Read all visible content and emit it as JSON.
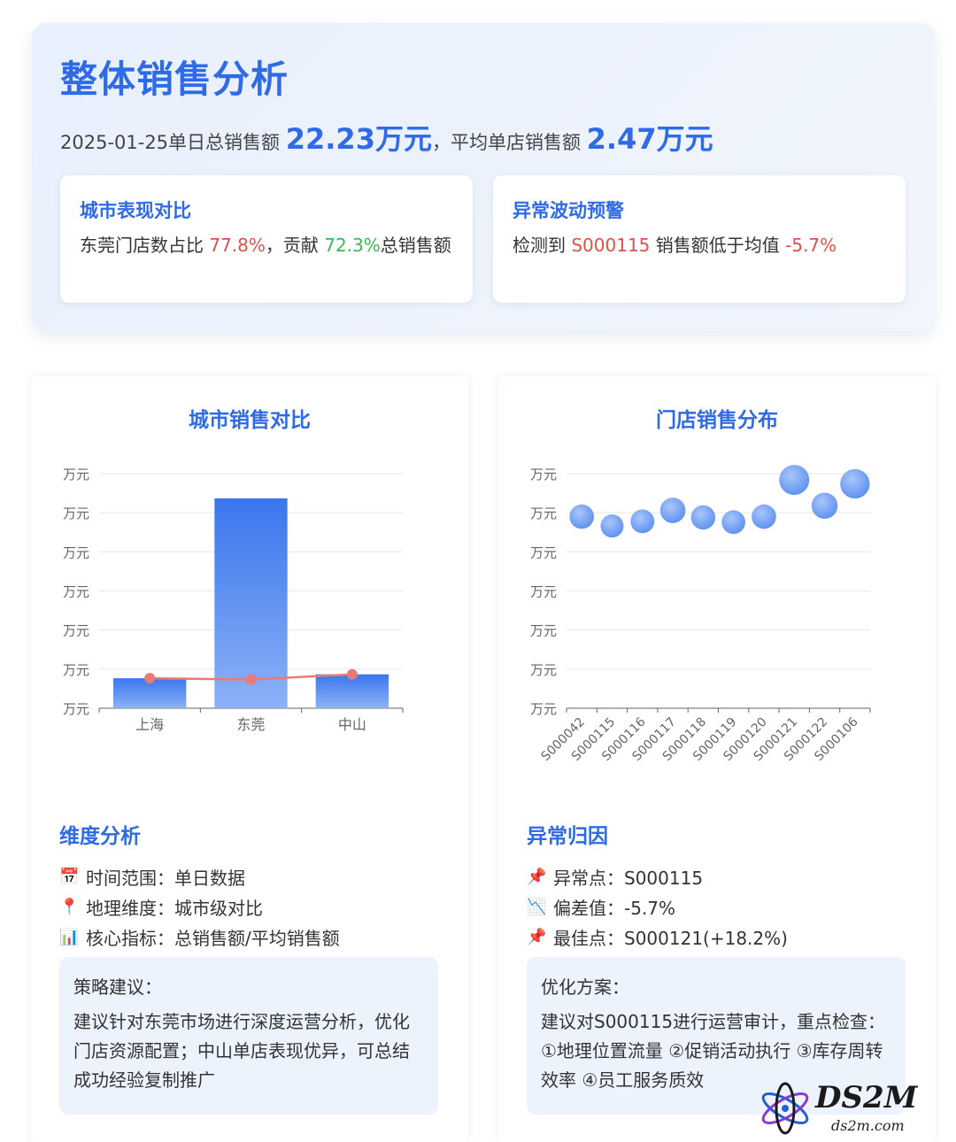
{
  "hero": {
    "title": "整体销售分析",
    "prefix": "2025-01-25单日总销售额",
    "total": "22.23万元",
    "sep": "，平均单店销售额",
    "avg": "2.47万元"
  },
  "cards": [
    {
      "title": "城市表现对比",
      "text_a": "东莞门店数占比",
      "val_a": "77.8%",
      "text_b": "，贡献",
      "val_b": "72.3%",
      "text_c": "总销售额"
    },
    {
      "title": "异常波动预警",
      "text_a": "检测到",
      "val_a": "S000115",
      "text_b": "销售额低于均值",
      "val_b": "-5.7%"
    }
  ],
  "left_panel": {
    "title": "城市销售对比",
    "section_title": "维度分析",
    "dims": [
      {
        "icon": "calendar-icon",
        "label": "时间范围：单日数据"
      },
      {
        "icon": "pin-icon",
        "label": "地理维度：城市级对比"
      },
      {
        "icon": "bar-chart-icon",
        "label": "核心指标：总销售额/平均销售额"
      }
    ],
    "box_title": "策略建议：",
    "box_text": "建议针对东莞市场进行深度运营分析，优化门店资源配置；中山单店表现优异，可总结成功经验复制推广"
  },
  "right_panel": {
    "title": "门店销售分布",
    "section_title": "异常归因",
    "dims": [
      {
        "icon": "pushpin-icon",
        "label": "异常点：S000115"
      },
      {
        "icon": "trend-down-icon",
        "label": "偏差值：-5.7%"
      },
      {
        "icon": "pushpin-icon",
        "label": "最佳点：S000121(+18.2%)"
      }
    ],
    "box_title": "优化方案：",
    "box_text": "建议对S000115进行运营审计，重点检查：①地理位置流量 ②促销活动执行 ③库存周转效率 ④员工服务质效"
  },
  "chart_data": [
    {
      "type": "bar",
      "title": "城市销售对比",
      "categories": [
        "上海",
        "东莞",
        "中山"
      ],
      "y_tick_labels": [
        "万元",
        "万元",
        "万元",
        "万元",
        "万元",
        "万元",
        "万元"
      ],
      "series": [
        {
          "kind": "bar",
          "values": [
            2.3,
            16.1,
            2.6
          ]
        },
        {
          "kind": "line",
          "values": [
            2.3,
            2.2,
            2.6
          ]
        }
      ],
      "ylim": [
        0,
        18
      ],
      "colors": {
        "bar_top": "#3a76ee",
        "bar_bottom": "#8cb1f6",
        "line": "#ea7a78"
      }
    },
    {
      "type": "scatter",
      "title": "门店销售分布",
      "categories": [
        "S000042",
        "S000115",
        "S000116",
        "S000117",
        "S000118",
        "S000119",
        "S000120",
        "S000121",
        "S000122",
        "S000106"
      ],
      "y_tick_labels": [
        "万元",
        "万元",
        "万元",
        "万元",
        "万元",
        "万元",
        "万元"
      ],
      "values": [
        2.45,
        2.33,
        2.39,
        2.53,
        2.44,
        2.38,
        2.45,
        2.92,
        2.59,
        2.87
      ],
      "ylim": [
        0,
        3
      ],
      "colors": {
        "point": "#5b8ff0"
      }
    }
  ],
  "watermark": {
    "brand": "DS2M",
    "domain": "ds2m.com"
  }
}
